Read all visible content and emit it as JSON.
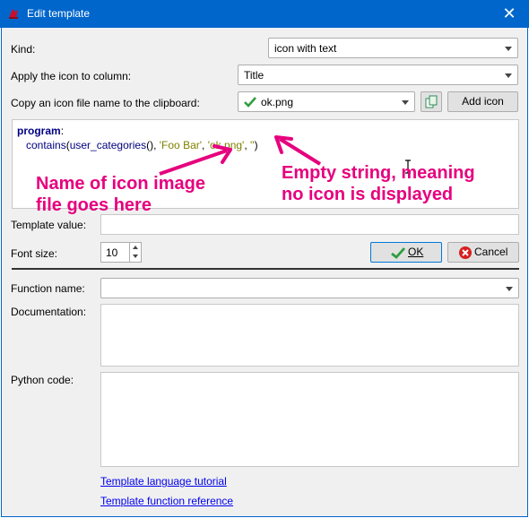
{
  "window": {
    "title": "Edit template",
    "close_glyph": "✕"
  },
  "kind": {
    "label": "Kind:",
    "value": "icon with text"
  },
  "apply_column": {
    "label": "Apply the icon to column:",
    "value": "Title"
  },
  "copy_icon": {
    "label": "Copy an icon file name to the clipboard:",
    "value": "ok.png",
    "add_label": "Add icon"
  },
  "code": {
    "keyword": "program",
    "colon": ":",
    "fn_name": "contains",
    "open_paren": "(",
    "inner_fn": "user_categories",
    "inner_call": "()",
    "sep1": ", ",
    "arg1": "'Foo Bar'",
    "sep2": ", ",
    "arg2": "'ok.png'",
    "sep3": ", ",
    "arg3": "''",
    "close_paren": ")"
  },
  "annotations": {
    "left_line1": "Name of icon image",
    "left_line2": "file goes here",
    "right_line1": "Empty string, meaning",
    "right_line2": "no icon is displayed",
    "color": "#e6007e"
  },
  "template_value": {
    "label": "Template value:",
    "value": ""
  },
  "font_size": {
    "label": "Font size:",
    "value": "10"
  },
  "buttons": {
    "ok": "OK",
    "cancel": "Cancel"
  },
  "function_name": {
    "label": "Function name:",
    "value": ""
  },
  "documentation": {
    "label": "Documentation:",
    "value": ""
  },
  "python_code": {
    "label": "Python code:",
    "value": ""
  },
  "links": {
    "tutorial": "Template language tutorial",
    "reference": "Template function reference"
  },
  "colors": {
    "titlebar": "#0066cc",
    "ok_check": "#2e9e3e",
    "cancel_icon": "#d62020"
  }
}
